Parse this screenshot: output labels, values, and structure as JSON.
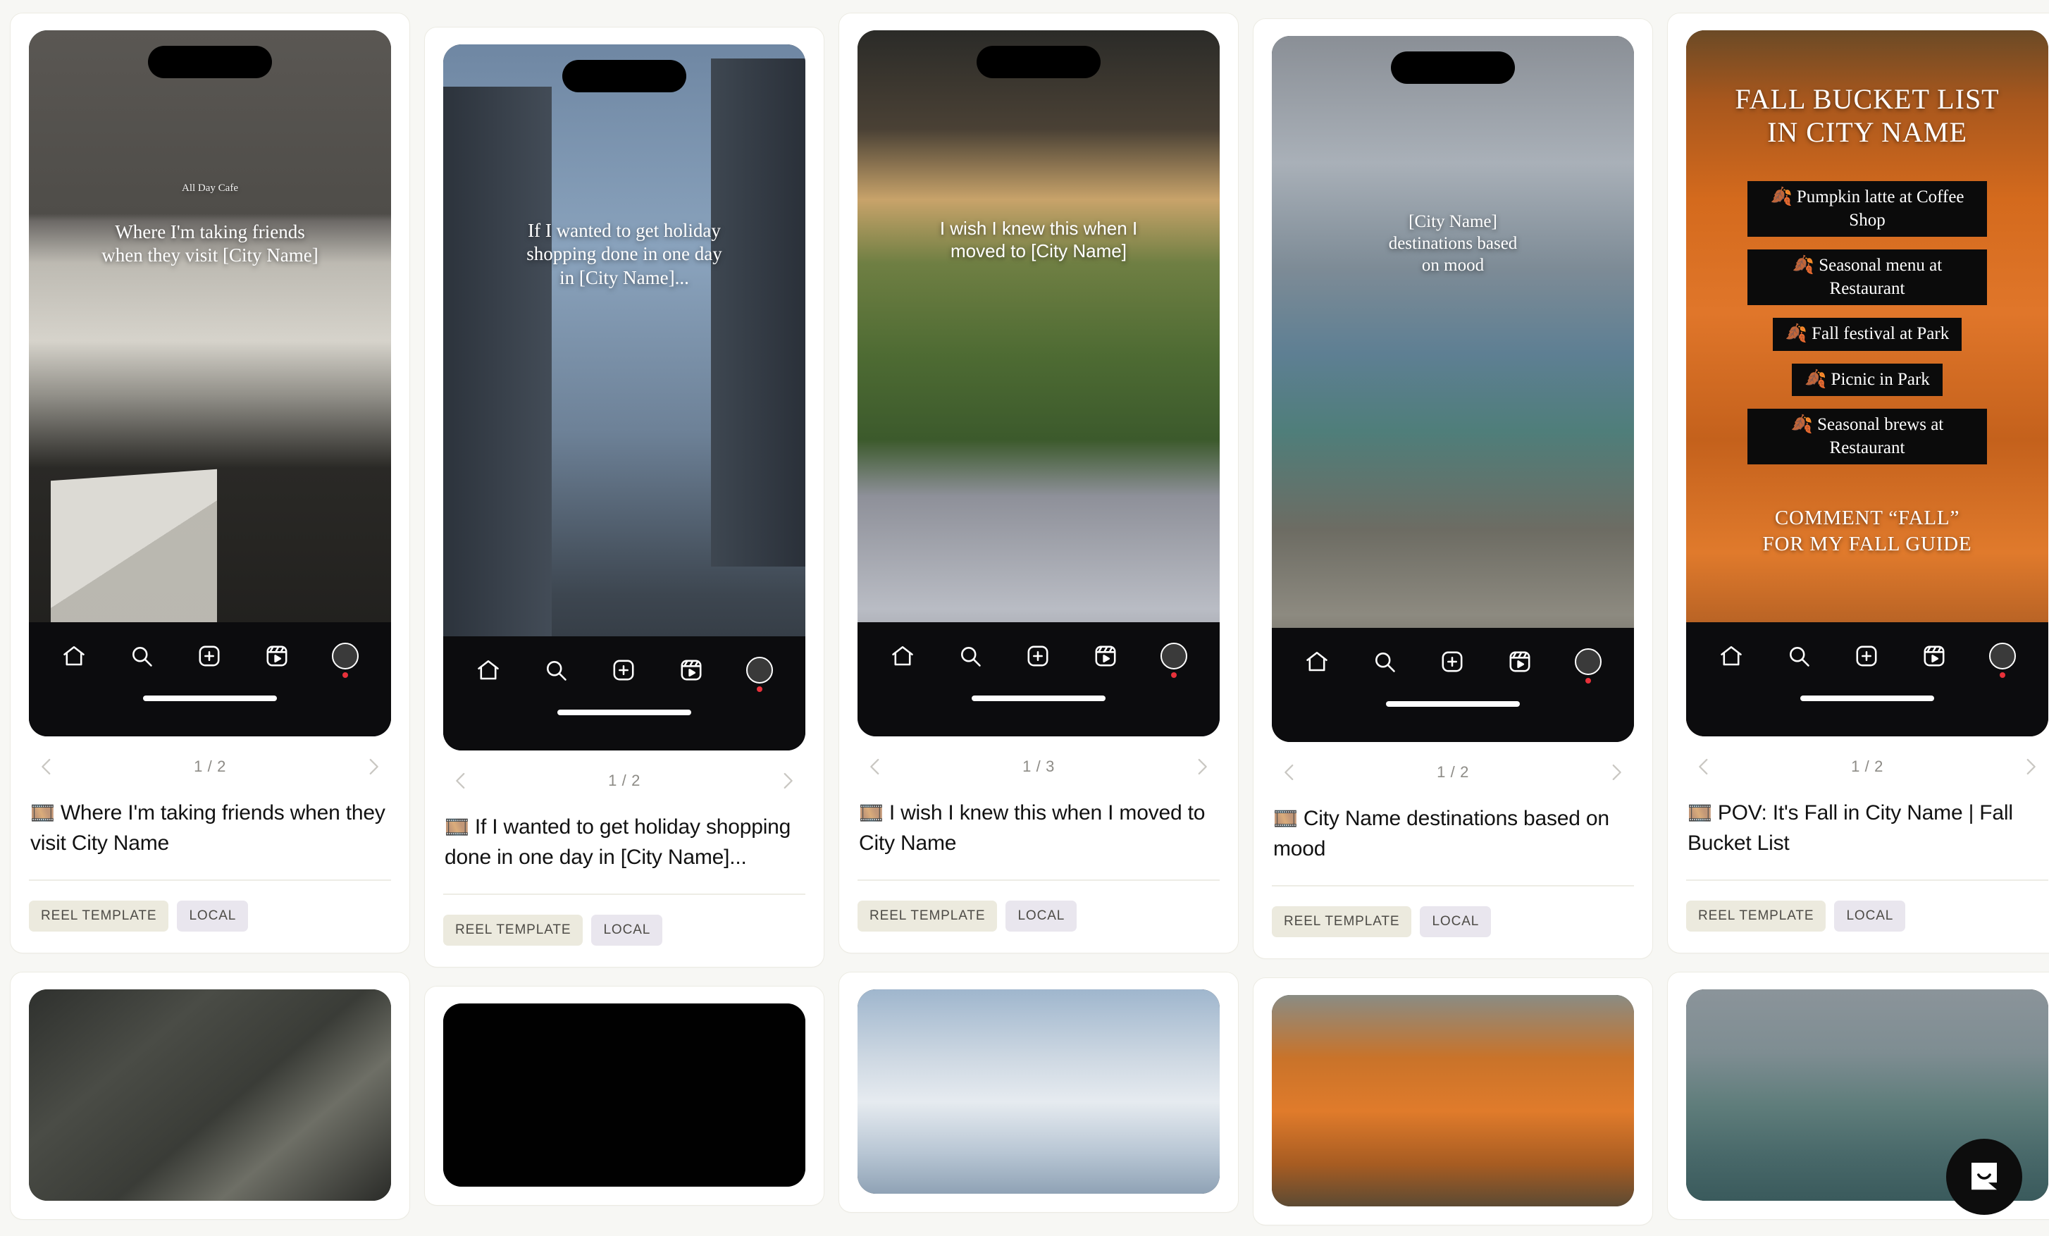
{
  "page": {
    "background_color": "#f7f7f4",
    "card_background": "#ffffff",
    "card_border_color": "#ecebe3"
  },
  "tags": {
    "reel_template": "REEL TEMPLATE",
    "local": "LOCAL",
    "reel_color": "#eceade",
    "local_color": "#e9e6ee"
  },
  "icons": {
    "home": "home-icon",
    "search": "search-icon",
    "add": "plus-square-icon",
    "reels": "reels-icon",
    "profile": "avatar-icon",
    "prev": "chevron-left-icon",
    "next": "chevron-right-icon",
    "chat": "chat-bubble-icon",
    "film": "film-frames-emoji"
  },
  "cards": [
    {
      "id": "card-1",
      "pager": "1 / 2",
      "caption_emoji": "🎞️",
      "caption": "Where I'm taking friends when they visit City Name",
      "overlay": {
        "style": "serif",
        "lines": [
          "Where I'm taking friends",
          "when they visit [City Name]"
        ],
        "sign": "All Day Cafe"
      },
      "tags": [
        "REEL TEMPLATE",
        "LOCAL"
      ]
    },
    {
      "id": "card-2",
      "pager": "1 / 2",
      "caption_emoji": "🎞️",
      "caption": "If I wanted to get holiday shopping done in one day in [City Name]...",
      "overlay": {
        "style": "serif",
        "lines": [
          "If I wanted to get holiday",
          "shopping done in one day",
          "in [City Name]..."
        ]
      },
      "tags": [
        "REEL TEMPLATE",
        "LOCAL"
      ]
    },
    {
      "id": "card-3",
      "pager": "1 / 3",
      "caption_emoji": "🎞️",
      "caption": "I wish I knew this when I moved to City Name",
      "overlay": {
        "style": "sans",
        "lines": [
          "I wish I knew this when I",
          "moved to [City Name]"
        ]
      },
      "tags": [
        "REEL TEMPLATE",
        "LOCAL"
      ]
    },
    {
      "id": "card-4",
      "pager": "1 / 2",
      "caption_emoji": "🎞️",
      "caption": "City Name destinations based on mood",
      "overlay": {
        "style": "serif",
        "lines": [
          "[City Name]",
          "destinations based",
          "on mood"
        ]
      },
      "tags": [
        "REEL TEMPLATE",
        "LOCAL"
      ]
    },
    {
      "id": "card-5",
      "pager": "1 / 2",
      "caption_emoji": "🎞️",
      "caption": "POV: It's Fall in City Name | Fall Bucket List",
      "overlay": {
        "style": "fall-bucket-list",
        "title_lines": [
          "FALL BUCKET LIST",
          "IN CITY NAME"
        ],
        "items": [
          "🍂 Pumpkin latte at Coffee Shop",
          "🍂 Seasonal menu at Restaurant",
          "🍂 Fall festival at Park",
          "🍂 Picnic in Park",
          "🍂 Seasonal brews at Restaurant"
        ],
        "cta_lines": [
          "COMMENT “FALL”",
          "FOR MY FALL GUIDE"
        ]
      },
      "tags": [
        "REEL TEMPLATE",
        "LOCAL"
      ]
    }
  ],
  "row2": [
    {
      "id": "card-6",
      "media": "m-shadow"
    },
    {
      "id": "card-7",
      "media": "m-dark"
    },
    {
      "id": "card-8",
      "media": "m-clouds"
    },
    {
      "id": "card-9",
      "media": "m-pump2"
    },
    {
      "id": "card-10",
      "media": "m-sea"
    }
  ]
}
